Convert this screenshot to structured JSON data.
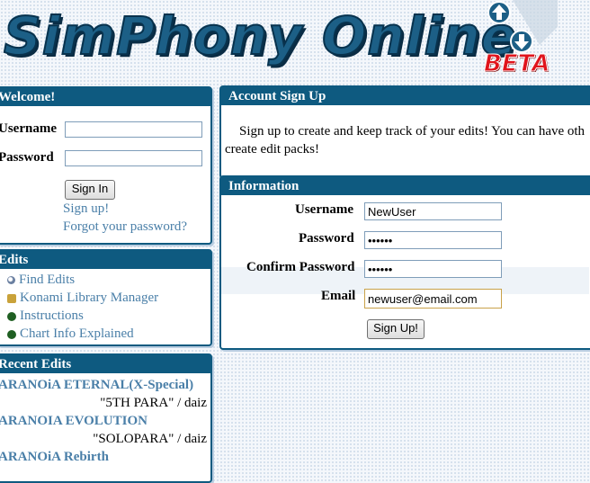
{
  "header": {
    "logo_text": "SimPhony Online",
    "beta_badge": "BETA"
  },
  "welcome": {
    "title": "Welcome!",
    "username_label": "Username",
    "password_label": "Password",
    "username_value": "",
    "password_value": "",
    "sign_in_button": "Sign In",
    "sign_up_link": "Sign up!",
    "forgot_link": "Forgot your password?"
  },
  "edits": {
    "title": "Edits",
    "items": [
      {
        "label": "Find Edits",
        "icon": "magnifier-icon"
      },
      {
        "label": "Konami Library Manager",
        "icon": "key-icon"
      },
      {
        "label": "Instructions",
        "icon": "bullet-icon"
      },
      {
        "label": "Chart Info Explained",
        "icon": "bullet-icon"
      }
    ]
  },
  "recent": {
    "title": "Recent Edits",
    "items": [
      {
        "title": "ARANOiA ETERNAL(X-Special)",
        "sub": "\"5TH PARA\" / daiz"
      },
      {
        "title": "ARANOIA EVOLUTION",
        "sub": "\"SOLOPARA\" / daiz"
      },
      {
        "title": "ARANOiA Rebirth",
        "sub": ""
      }
    ]
  },
  "signup": {
    "title": "Account Sign Up",
    "intro": "Sign up to create and keep track of your edits! You can have other users view them, rate them, and create edit packs!",
    "intro_line1": "Sign up to create and keep track of your edits! You can have oth",
    "intro_line2": "create edit packs!"
  },
  "info": {
    "title": "Information",
    "username_label": "Username",
    "username_value": "NewUser",
    "password_label": "Password",
    "password_value": "••••••",
    "confirm_label": "Confirm Password",
    "confirm_value": "••••••",
    "email_label": "Email",
    "email_value": "newuser@email.com",
    "submit_button": "Sign Up!"
  },
  "colors": {
    "panel_header": "#0e5a80",
    "link": "#4a7fa8",
    "beta": "#e0141c"
  }
}
